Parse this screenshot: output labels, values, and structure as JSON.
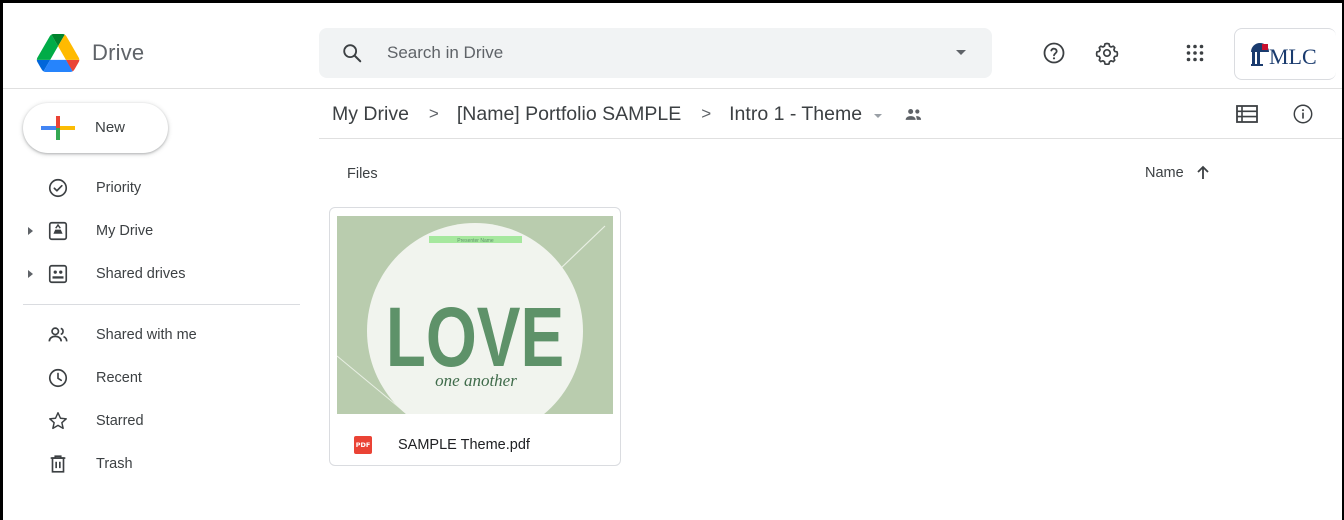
{
  "app": {
    "name": "Drive",
    "org_badge_text": "MLC"
  },
  "search": {
    "placeholder": "Search in Drive"
  },
  "header_icons": [
    "help-icon",
    "settings-icon",
    "apps-icon"
  ],
  "sidebar": {
    "new_label": "New",
    "items": [
      {
        "label": "Priority",
        "icon": "priority-check-icon",
        "expandable": false
      },
      {
        "label": "My Drive",
        "icon": "my-drive-icon",
        "expandable": true
      },
      {
        "label": "Shared drives",
        "icon": "shared-drives-icon",
        "expandable": true
      },
      {
        "label": "Shared with me",
        "icon": "people-icon",
        "expandable": false
      },
      {
        "label": "Recent",
        "icon": "clock-icon",
        "expandable": false
      },
      {
        "label": "Starred",
        "icon": "star-icon",
        "expandable": false
      },
      {
        "label": "Trash",
        "icon": "trash-icon",
        "expandable": false
      }
    ]
  },
  "breadcrumb": {
    "items": [
      "My Drive",
      "[Name] Portfolio SAMPLE",
      "Intro 1 - Theme"
    ],
    "separator": ">"
  },
  "files_section": {
    "label": "Files",
    "sort_label": "Name",
    "sort_direction": "ascending"
  },
  "files": [
    {
      "name": "SAMPLE Theme.pdf",
      "type_badge": "PDF",
      "thumbnail": {
        "title": "LOVE",
        "subtitle": "one another",
        "banner": "Presenter Name"
      }
    }
  ],
  "colors": {
    "accent_blue": "#1a73e8",
    "pdf_red": "#ea4335",
    "thumb_green": "#b8ccad",
    "love_green": "#5e9269"
  }
}
